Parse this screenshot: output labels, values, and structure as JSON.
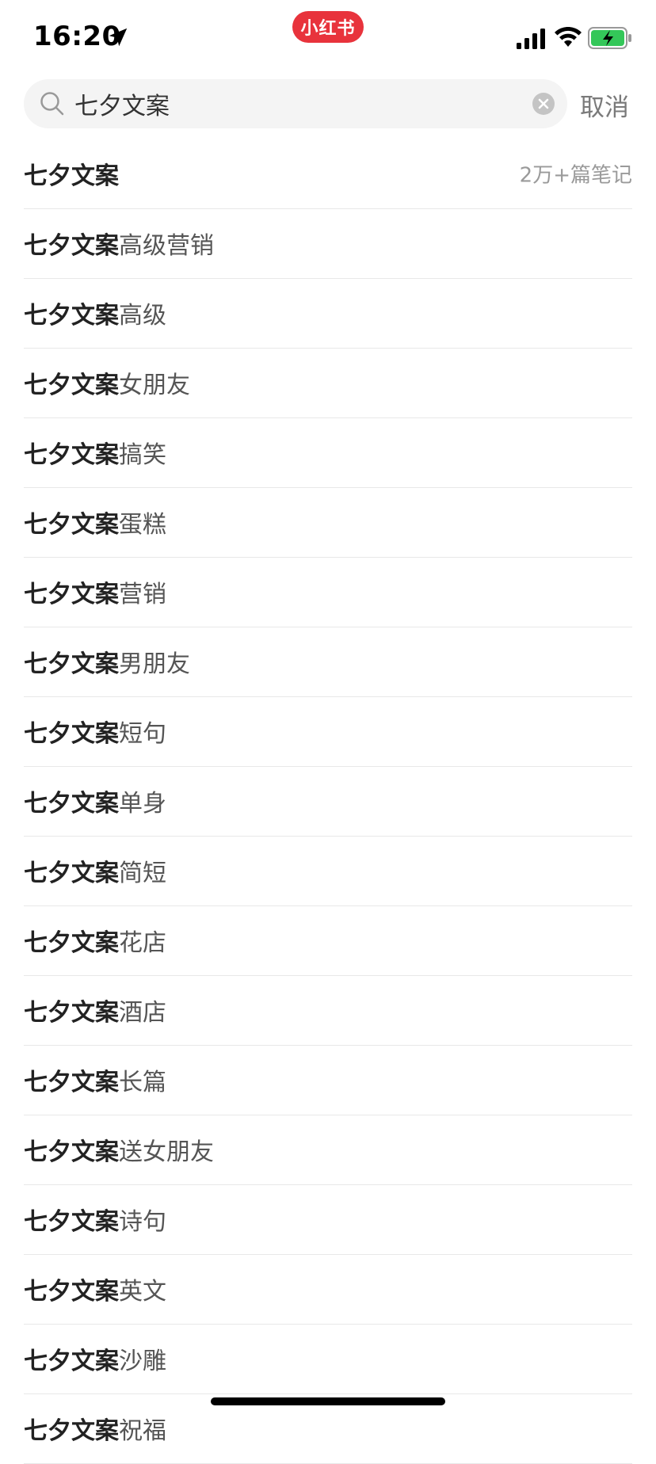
{
  "status_bar": {
    "time": "16:20",
    "app_badge": "小红书",
    "icons": [
      "location-arrow-icon",
      "cellular-signal-icon",
      "wifi-icon",
      "battery-charging-icon"
    ],
    "battery_color": "#34c759"
  },
  "search": {
    "value": "七夕文案",
    "placeholder": "",
    "cancel_label": "取消",
    "icons": [
      "search-icon",
      "clear-icon"
    ]
  },
  "suggestions": {
    "query": "七夕文案",
    "top_count": "2万+篇笔记",
    "suffixes": [
      "",
      "高级营销",
      "高级",
      "女朋友",
      "搞笑",
      "蛋糕",
      "营销",
      "男朋友",
      "短句",
      "单身",
      "简短",
      "花店",
      "酒店",
      "长篇",
      "送女朋友",
      "诗句",
      "英文",
      "沙雕",
      "祝福"
    ]
  },
  "colors": {
    "brand": "#e8333c",
    "divider": "#e8e8e8",
    "search_bg": "#f4f4f4",
    "muted_text": "#9a9a9a"
  }
}
